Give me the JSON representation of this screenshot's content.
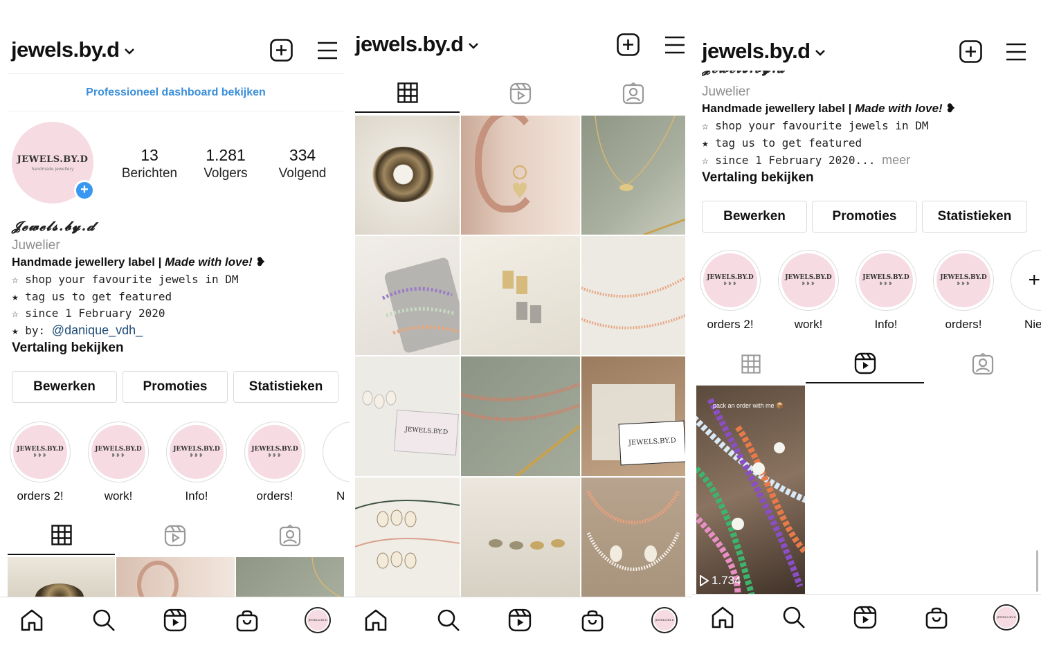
{
  "account": {
    "username": "jewels.by.d",
    "display_name": "𝓙𝓮𝔀𝓮𝓵𝓼.𝓫𝔂.𝓭",
    "category": "Juwelier"
  },
  "dashboard_link": "Professioneel dashboard bekijken",
  "stats": {
    "posts": {
      "value": "13",
      "label": "Berichten"
    },
    "followers": {
      "value": "1.281",
      "label": "Volgers"
    },
    "following": {
      "value": "334",
      "label": "Volgend"
    }
  },
  "avatar": {
    "logo": "JEWELS.BY.D",
    "sub": "handmade jewellery"
  },
  "bio": {
    "line1_prefix": "Handmade jewellery label | ",
    "line1_italic": "Made with love!",
    "line1_suffix": " ❥",
    "line2": "☆ shop your favourite jewels in DM",
    "line3": "★ tag us to get featured",
    "line4": "☆ since 1 February 2020",
    "line4_truncated": "☆ since 1 February 2020...",
    "more": "meer",
    "line5_prefix": "★ by: ",
    "line5_handle": "@danique_vdh_",
    "translate": "Vertaling bekijken"
  },
  "buttons": {
    "edit": "Bewerken",
    "promotions": "Promoties",
    "insights": "Statistieken"
  },
  "highlights": [
    {
      "label": "orders 2!",
      "logo": "JEWELS.BY.D",
      "dots": "❥❥❥"
    },
    {
      "label": "work!",
      "logo": "JEWELS.BY.D",
      "dots": "❥❥❥"
    },
    {
      "label": "Info!",
      "logo": "JEWELS.BY.D",
      "dots": "❥❥❥"
    },
    {
      "label": "orders!",
      "logo": "JEWELS.BY.D",
      "dots": "❥❥❥"
    }
  ],
  "new_highlight_label": "Nieuw",
  "new_highlight_label_cut_p1": "N",
  "new_highlight_label_cut_p3": "Nie",
  "card_logo": "JEWELS.BY.D",
  "reel": {
    "caption": "pack an order with me 📦",
    "views": "1.734"
  },
  "colors": {
    "accent_blue": "#3897f0",
    "link_blue": "#3a8ed8",
    "highlight_pink": "#f6dbe3",
    "muted": "#8e8e8e"
  },
  "icons": [
    "chevron-down-icon",
    "new-post-icon",
    "menu-icon",
    "grid-icon",
    "reels-icon",
    "tagged-icon",
    "home-icon",
    "search-icon",
    "shop-icon",
    "profile-avatar"
  ]
}
